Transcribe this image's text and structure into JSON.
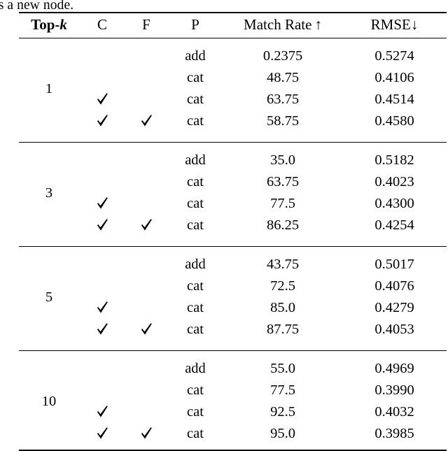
{
  "caption_fragment": "as a new node.",
  "table": {
    "columns": [
      {
        "key": "topk",
        "label": "Top-",
        "label_italic": "k",
        "bold_header": true
      },
      {
        "key": "c",
        "label": "C"
      },
      {
        "key": "f",
        "label": "F"
      },
      {
        "key": "p",
        "label": "P"
      },
      {
        "key": "match",
        "label": "Match Rate",
        "arrow": "↑",
        "arrow_spaced": true
      },
      {
        "key": "rmse",
        "label": "RMSE",
        "arrow": "↓",
        "arrow_spaced": false
      }
    ],
    "checkmark_glyph": "✓",
    "groups": [
      {
        "topk": "1",
        "rows": [
          {
            "c": false,
            "f": false,
            "p": "add",
            "match": "0.2375",
            "match_bold": false,
            "rmse": "0.5274",
            "rmse_bold": false
          },
          {
            "c": false,
            "f": false,
            "p": "cat",
            "match": "48.75",
            "match_bold": false,
            "rmse": "0.4106",
            "rmse_bold": true
          },
          {
            "c": true,
            "f": false,
            "p": "cat",
            "match": "63.75",
            "match_bold": true,
            "rmse": "0.4514",
            "rmse_bold": false
          },
          {
            "c": true,
            "f": true,
            "p": "cat",
            "match": "58.75",
            "match_bold": false,
            "rmse": "0.4580",
            "rmse_bold": false
          }
        ]
      },
      {
        "topk": "3",
        "rows": [
          {
            "c": false,
            "f": false,
            "p": "add",
            "match": "35.0",
            "match_bold": false,
            "rmse": "0.5182",
            "rmse_bold": false
          },
          {
            "c": false,
            "f": false,
            "p": "cat",
            "match": "63.75",
            "match_bold": false,
            "rmse": "0.4023",
            "rmse_bold": true
          },
          {
            "c": true,
            "f": false,
            "p": "cat",
            "match": "77.5",
            "match_bold": false,
            "rmse": "0.4300",
            "rmse_bold": false
          },
          {
            "c": true,
            "f": true,
            "p": "cat",
            "match": "86.25",
            "match_bold": true,
            "rmse": "0.4254",
            "rmse_bold": false
          }
        ]
      },
      {
        "topk": "5",
        "rows": [
          {
            "c": false,
            "f": false,
            "p": "add",
            "match": "43.75",
            "match_bold": false,
            "rmse": "0.5017",
            "rmse_bold": false
          },
          {
            "c": false,
            "f": false,
            "p": "cat",
            "match": "72.5",
            "match_bold": false,
            "rmse": "0.4076",
            "rmse_bold": false
          },
          {
            "c": true,
            "f": false,
            "p": "cat",
            "match": "85.0",
            "match_bold": false,
            "rmse": "0.4279",
            "rmse_bold": false
          },
          {
            "c": true,
            "f": true,
            "p": "cat",
            "match": "87.75",
            "match_bold": true,
            "rmse": "0.4053",
            "rmse_bold": true
          }
        ]
      },
      {
        "topk": "10",
        "rows": [
          {
            "c": false,
            "f": false,
            "p": "add",
            "match": "55.0",
            "match_bold": false,
            "rmse": "0.4969",
            "rmse_bold": false
          },
          {
            "c": false,
            "f": false,
            "p": "cat",
            "match": "77.5",
            "match_bold": false,
            "rmse": "0.3990",
            "rmse_bold": false
          },
          {
            "c": true,
            "f": false,
            "p": "cat",
            "match": "92.5",
            "match_bold": false,
            "rmse": "0.4032",
            "rmse_bold": false
          },
          {
            "c": true,
            "f": true,
            "p": "cat",
            "match": "95.0",
            "match_bold": true,
            "rmse": "0.3985",
            "rmse_bold": true
          }
        ]
      }
    ]
  }
}
